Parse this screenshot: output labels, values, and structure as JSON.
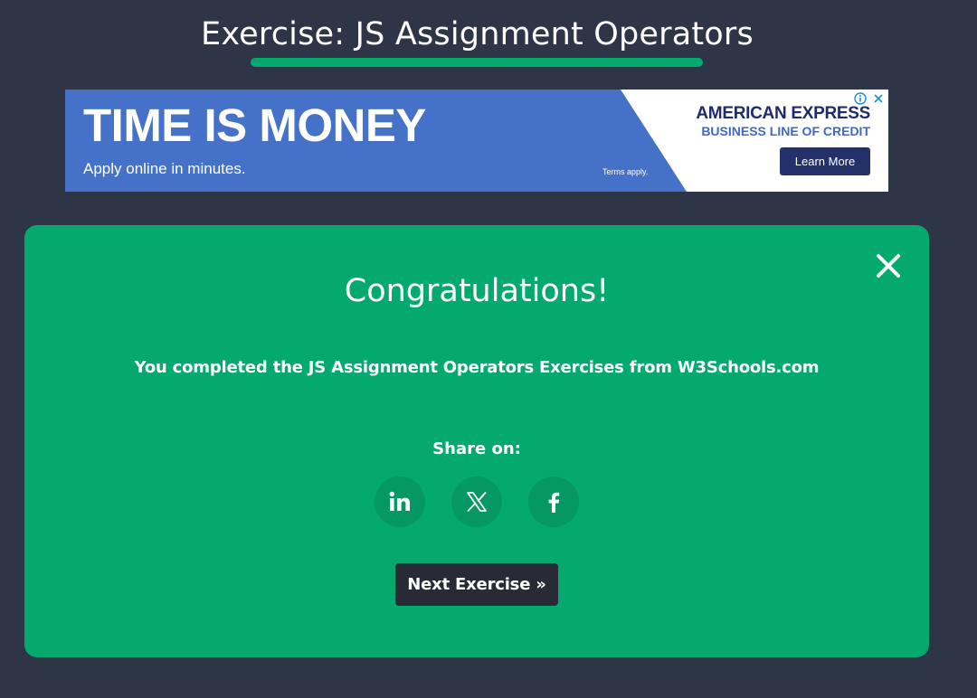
{
  "page": {
    "title": "Exercise: JS Assignment Operators"
  },
  "ad": {
    "headline": "TIME IS MONEY",
    "subtext": "Apply online in minutes.",
    "terms": "Terms apply.",
    "brand": "AMERICAN EXPRESS",
    "brand_sub": "BUSINESS LINE OF CREDIT",
    "cta": "Learn More",
    "icons": [
      "info-icon",
      "close-icon"
    ]
  },
  "modal": {
    "heading": "Congratulations!",
    "message": "You completed the JS Assignment Operators Exercises from W3Schools.com",
    "share_label": "Share on:",
    "share_icons": [
      "linkedin-icon",
      "x-icon",
      "facebook-icon"
    ],
    "next_label": "Next Exercise »",
    "close_icon": "close-icon"
  },
  "colors": {
    "background": "#2e3546",
    "accent": "#04aa6d",
    "share_button": "#059862",
    "next_button": "#282a35",
    "ad_blue": "#4671c8",
    "ad_navy": "#23306a"
  }
}
